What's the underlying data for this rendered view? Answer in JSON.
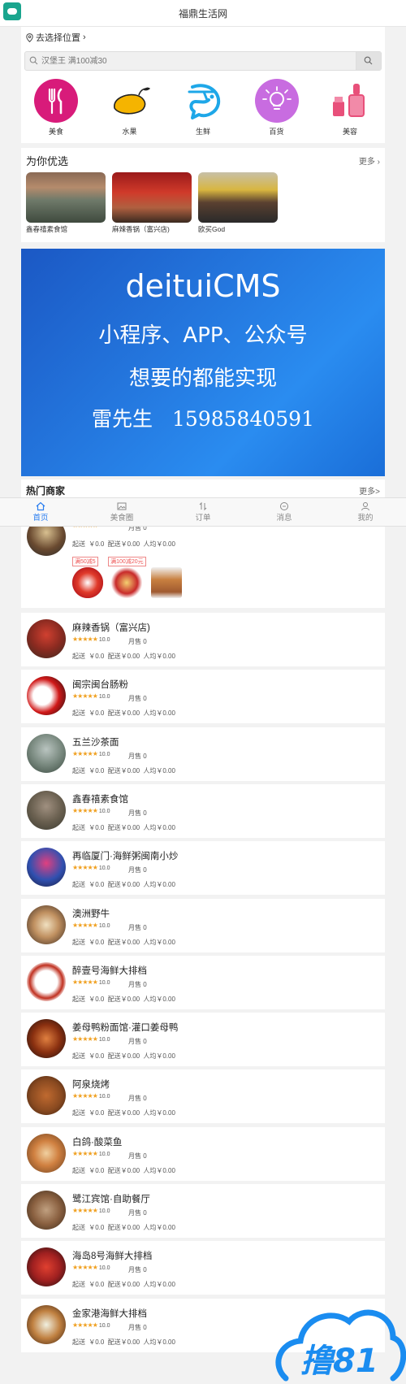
{
  "app": {
    "title": "福鼎生活网"
  },
  "location": {
    "label": "去选择位置"
  },
  "search": {
    "placeholder": "汉堡王 满100减30"
  },
  "categories": [
    {
      "label": "美食",
      "icon": "utensils-icon",
      "color": "#d81b7a"
    },
    {
      "label": "水果",
      "icon": "mango-icon",
      "color": "#f5b400"
    },
    {
      "label": "生鲜",
      "icon": "shrimp-icon",
      "color": "#1ea7e8"
    },
    {
      "label": "百货",
      "icon": "lightbulb-icon",
      "color": "#c86ce0"
    },
    {
      "label": "美容",
      "icon": "lipstick-icon",
      "color": "#e8507a"
    }
  ],
  "recommend": {
    "title": "为你优选",
    "more": "更多",
    "items": [
      {
        "name": "鑫春禧素食馆"
      },
      {
        "name": "麻辣香锅（富兴店)"
      },
      {
        "name": "欧买God"
      }
    ]
  },
  "banner": {
    "line1": "deituiCMS",
    "line2": "小程序、APP、公众号",
    "line3": "想要的都能实现",
    "line4_name": "雷先生",
    "line4_phone": "15985840591"
  },
  "hot": {
    "title": "热门商家",
    "more": "更多>"
  },
  "tabs": [
    {
      "label": "首页",
      "icon": "home-icon",
      "active": true
    },
    {
      "label": "美食圈",
      "icon": "image-icon",
      "active": false
    },
    {
      "label": "订单",
      "icon": "sort-icon",
      "active": false
    },
    {
      "label": "消息",
      "icon": "message-icon",
      "active": false
    },
    {
      "label": "我的",
      "icon": "user-icon",
      "active": false
    }
  ],
  "first_shop": {
    "sold": "月售 0",
    "fees": "起送 ￥0.0 配送￥0.00 人均￥0.00",
    "coupons": [
      "满50减5",
      "满100减20元"
    ]
  },
  "shops": [
    {
      "name": "麻辣香锅（富兴店)",
      "score": "10.0",
      "sold": "月售 0",
      "fees": "起送 ￥0.0 配送￥0.00 人均￥0.00"
    },
    {
      "name": "闽宗闽台肠粉",
      "score": "10.0",
      "sold": "月售 0",
      "fees": "起送 ￥0.0 配送￥0.00 人均￥0.00"
    },
    {
      "name": "五兰沙茶面",
      "score": "10.0",
      "sold": "月售 0",
      "fees": "起送 ￥0.0 配送￥0.00 人均￥0.00"
    },
    {
      "name": "鑫春禧素食馆",
      "score": "10.0",
      "sold": "月售 0",
      "fees": "起送 ￥0.0 配送￥0.00 人均￥0.00"
    },
    {
      "name": "再临厦门·海鲜粥闽南小炒",
      "score": "10.0",
      "sold": "月售 0",
      "fees": "起送 ￥0.0 配送￥0.00 人均￥0.00"
    },
    {
      "name": "澳洲野牛",
      "score": "10.0",
      "sold": "月售 0",
      "fees": "起送 ￥0.0 配送￥0.00 人均￥0.00"
    },
    {
      "name": "醉壹号海鲜大排档",
      "score": "10.0",
      "sold": "月售 0",
      "fees": "起送 ￥0.0 配送￥0.00 人均￥0.00"
    },
    {
      "name": "姜母鸭粉面馆·灌口姜母鸭",
      "score": "10.0",
      "sold": "月售 0",
      "fees": "起送 ￥0.0 配送￥0.00 人均￥0.00"
    },
    {
      "name": "阿泉烧烤",
      "score": "10.0",
      "sold": "月售 0",
      "fees": "起送 ￥0.0 配送￥0.00 人均￥0.00"
    },
    {
      "name": "白鸽·酸菜鱼",
      "score": "10.0",
      "sold": "月售 0",
      "fees": "起送 ￥0.0 配送￥0.00 人均￥0.00"
    },
    {
      "name": "鹭江宾馆·自助餐厅",
      "score": "10.0",
      "sold": "月售 0",
      "fees": "起送 ￥0.0 配送￥0.00 人均￥0.00"
    },
    {
      "name": "海岛8号海鲜大排档",
      "score": "10.0",
      "sold": "月售 0",
      "fees": "起送 ￥0.0 配送￥0.00 人均￥0.00"
    },
    {
      "name": "金家港海鲜大排档",
      "score": "10.0",
      "sold": "月售 0",
      "fees": "起送 ￥0.0 配送￥0.00 人均￥0.00"
    }
  ],
  "stars": "★★★★★",
  "watermark": {
    "text": "撸81"
  }
}
